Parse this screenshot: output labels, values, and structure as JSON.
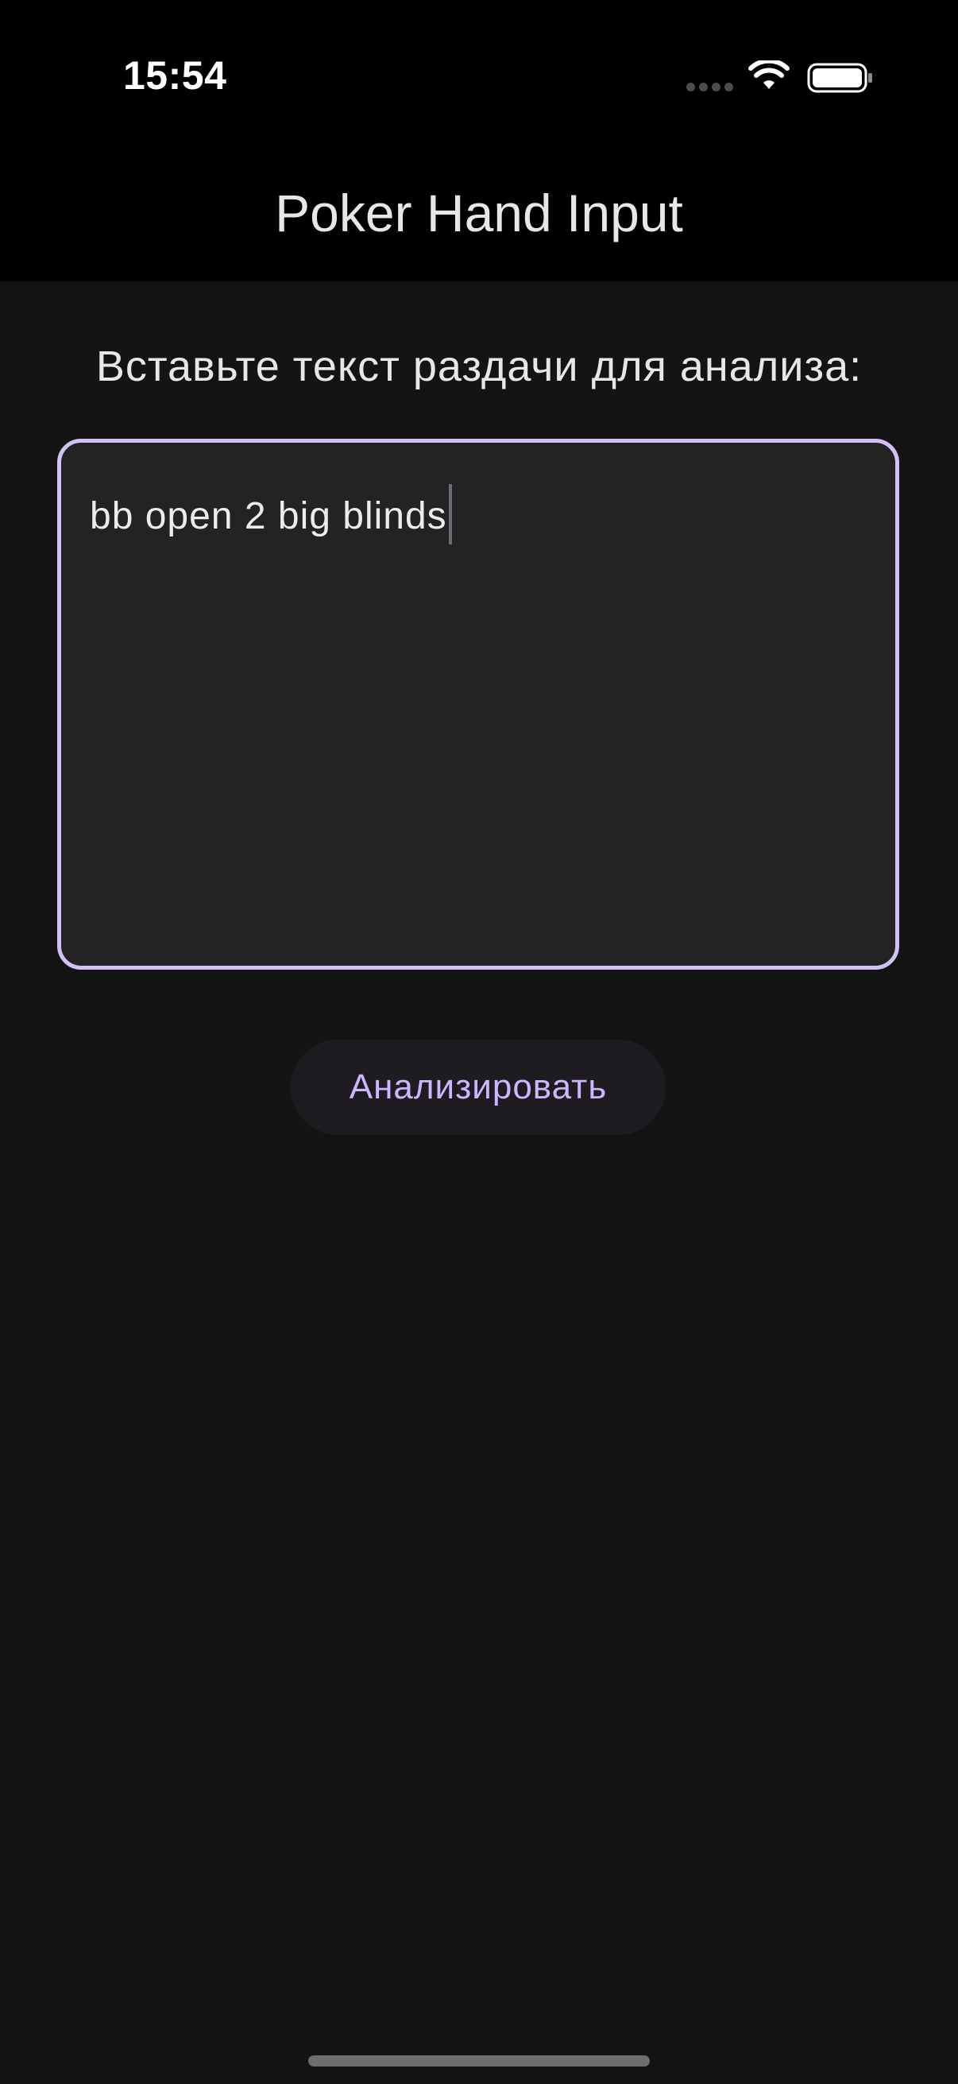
{
  "status_bar": {
    "time": "15:54"
  },
  "app_bar": {
    "title": "Poker Hand Input"
  },
  "main": {
    "prompt": "Вставьте текст раздачи для анализа:",
    "hand_input": {
      "value": "bb open 2 big blinds",
      "placeholder": ""
    },
    "analyze_button_label": "Анализировать"
  },
  "icons": {
    "signal": "signal-dots-icon",
    "wifi": "wifi-icon",
    "battery": "battery-icon"
  },
  "colors": {
    "background": "#141414",
    "app_bar": "#000000",
    "input_border": "#d3c1f6",
    "input_fill": "#232323",
    "button_text": "#cdb6ff",
    "button_fill": "#1e1c21"
  }
}
